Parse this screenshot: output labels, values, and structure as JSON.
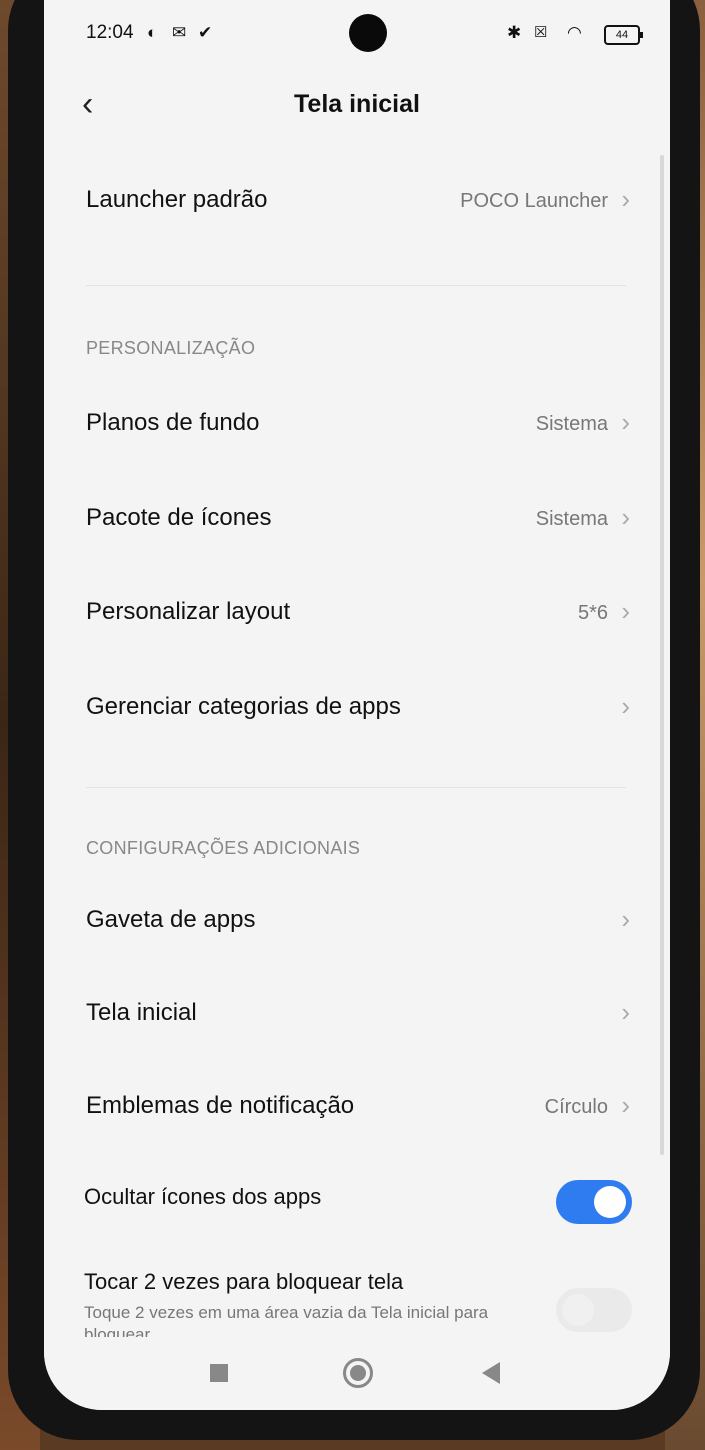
{
  "status_bar": {
    "time": "12:04",
    "battery": "44",
    "icons": [
      "circle-icon",
      "mail-icon",
      "check-circle-icon",
      "bluetooth-icon",
      "no-sim-icon",
      "wifi-icon",
      "battery-icon"
    ]
  },
  "header": {
    "title": "Tela inicial"
  },
  "launcher": {
    "label": "Launcher padrão",
    "value": "POCO Launcher"
  },
  "personalization": {
    "header": "PERSONALIZAÇÃO",
    "items": [
      {
        "label": "Planos de fundo",
        "value": "Sistema"
      },
      {
        "label": "Pacote de ícones",
        "value": "Sistema"
      },
      {
        "label": "Personalizar layout",
        "value": "5*6"
      },
      {
        "label": "Gerenciar categorias de apps",
        "value": ""
      }
    ]
  },
  "additional": {
    "header": "CONFIGURAÇÕES ADICIONAIS",
    "items": [
      {
        "label": "Gaveta de apps",
        "value": ""
      },
      {
        "label": "Tela inicial",
        "value": ""
      },
      {
        "label": "Emblemas de notificação",
        "value": "Círculo"
      }
    ],
    "hide_icons": {
      "label": "Ocultar ícones dos apps",
      "on": true
    },
    "double_tap": {
      "label": "Tocar 2 vezes para bloquear tela",
      "subtitle": "Toque 2 vezes em uma área vazia da Tela inicial para",
      "subtitle2": "bloquear",
      "on": false
    }
  },
  "colors": {
    "accent": "#2f7bf0",
    "background": "#f4f4f4"
  }
}
